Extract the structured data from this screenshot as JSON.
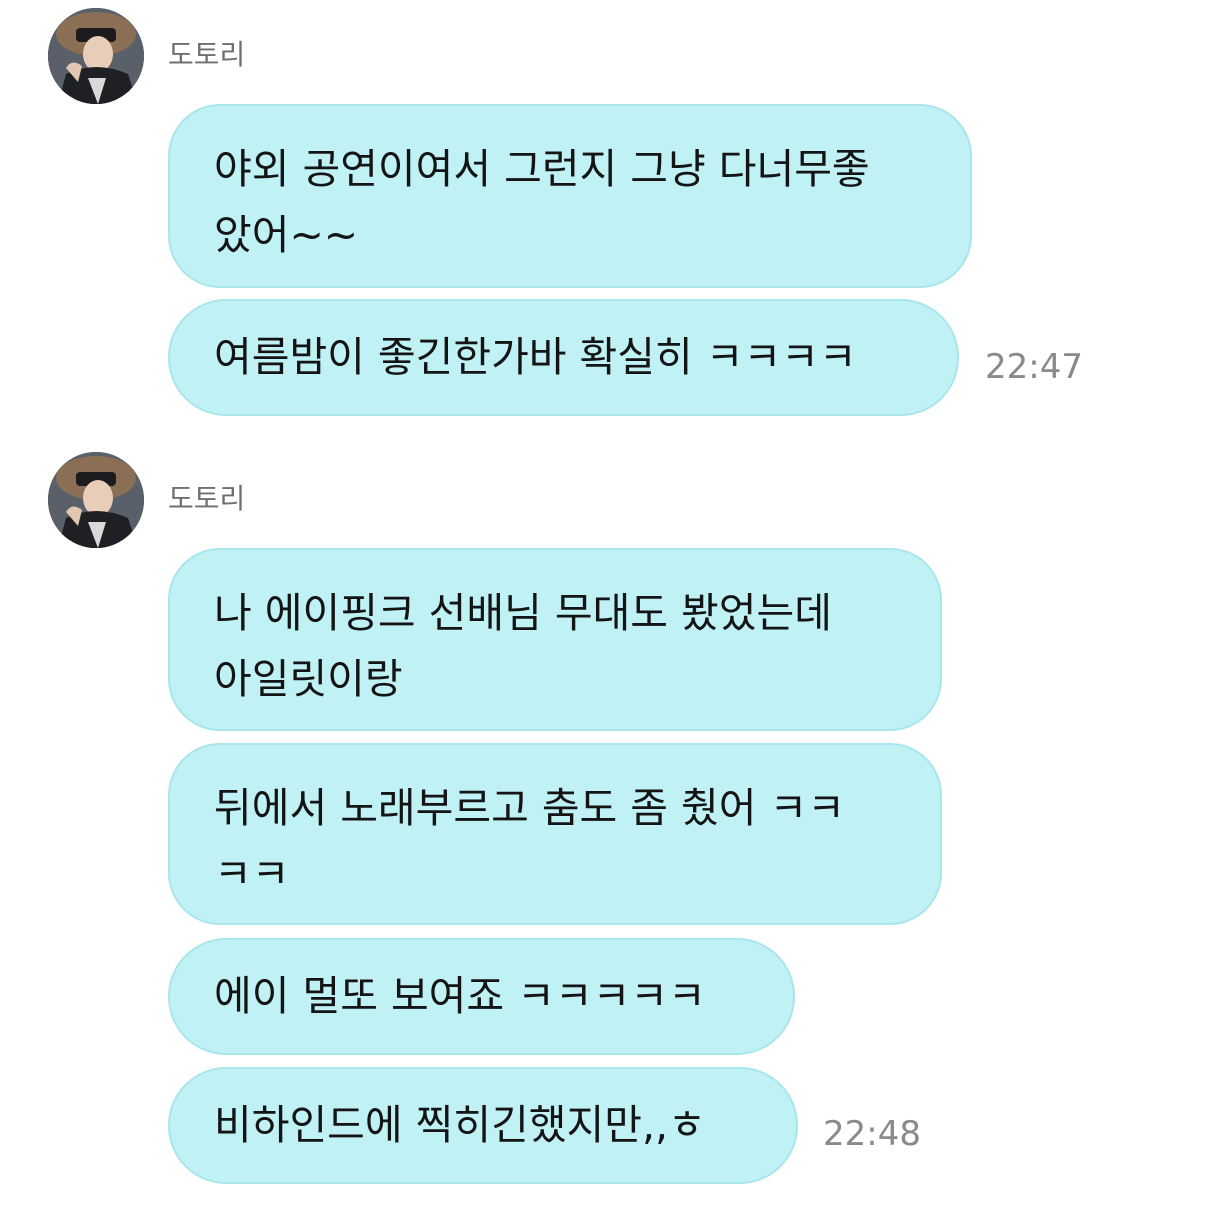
{
  "groups": [
    {
      "sender": "도토리",
      "messages": [
        {
          "text": "야외 공연이여서 그런지 그냥 다너무좋\n았어~~"
        },
        {
          "text": "여름밤이 좋긴한가바 확실히 ㅋㅋㅋㅋ"
        }
      ],
      "time": "22:47"
    },
    {
      "sender": "도토리",
      "messages": [
        {
          "text": "나 에이핑크 선배님 무대도 봤었는데\n아일릿이랑"
        },
        {
          "text": "뒤에서 노래부르고 춤도 좀 췄어 ㅋㅋ\nㅋㅋ"
        },
        {
          "text": "에이 멀또 보여죠 ㅋㅋㅋㅋㅋ"
        },
        {
          "text": "비하인드에 찍히긴했지만,,ㅎ"
        }
      ],
      "time": "22:48"
    }
  ],
  "colors": {
    "bubble_bg": "#bff1f5",
    "bubble_border": "#a9e6ec",
    "name_text": "#6f6f6f",
    "time_text": "#8a8a8a"
  },
  "icons": {
    "avatar": "profile-photo"
  }
}
